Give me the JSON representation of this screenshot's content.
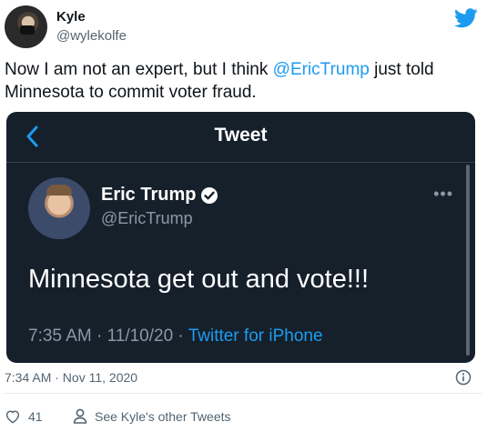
{
  "author": {
    "name": "Kyle",
    "handle": "@wylekolfe"
  },
  "tweet": {
    "text_before": "Now I am not an expert, but I think ",
    "mention": "@EricTrump",
    "text_after": " just told Minnesota to commit voter fraud.",
    "timestamp": "7:34 AM · Nov 11, 2020",
    "like_count": "41",
    "see_other_label": "See Kyle's other Tweets"
  },
  "embedded_screenshot": {
    "header_title": "Tweet",
    "name": "Eric Trump",
    "handle": "@EricTrump",
    "text": "Minnesota get out and vote!!!",
    "meta_time": "7:35 AM · 11/10/20 · ",
    "meta_source": "Twitter for iPhone",
    "more_glyph": "•••"
  },
  "colors": {
    "accent": "#1d9bf0",
    "dark_bg": "#15202b",
    "secondary_text": "#536471"
  },
  "icons": {
    "brand": "twitter-bird-icon",
    "back": "chevron-left-icon",
    "verified": "verified-badge-icon",
    "more": "more-dots-icon",
    "info": "info-icon",
    "like": "heart-icon",
    "person": "person-icon"
  }
}
